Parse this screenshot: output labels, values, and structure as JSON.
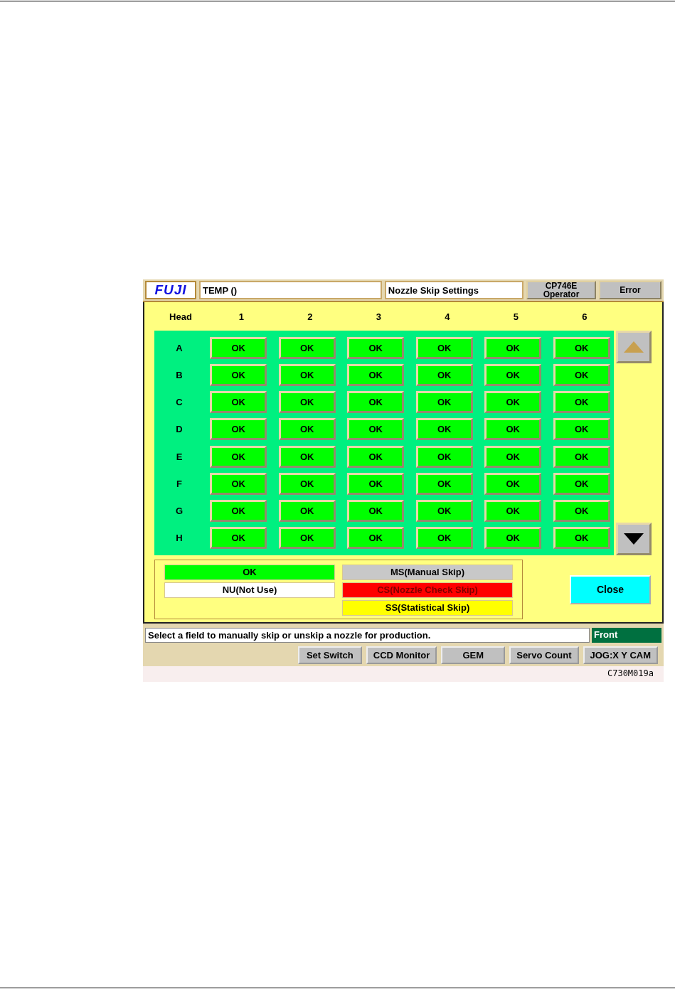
{
  "header": {
    "logo": "FUJI",
    "file": "TEMP  ()",
    "screen_title": "Nozzle Skip Settings",
    "machine": [
      "CP746E",
      "Operator"
    ],
    "error_button": "Error"
  },
  "grid": {
    "corner": "Head",
    "columns": [
      "1",
      "2",
      "3",
      "4",
      "5",
      "6"
    ],
    "rows": [
      {
        "label": "A",
        "cells": [
          {
            "color": "#00ff00",
            "text": "OK"
          },
          {
            "color": "#00ff00",
            "text": "OK"
          },
          {
            "color": "#00ff00",
            "text": "OK"
          },
          {
            "color": "#00ff00",
            "text": "OK"
          },
          {
            "color": "#00ff00",
            "text": "OK"
          },
          {
            "color": "#00ff00",
            "text": "OK"
          }
        ]
      },
      {
        "label": "B",
        "cells": [
          {
            "color": "#00ff00",
            "text": "OK"
          },
          {
            "color": "#00ff00",
            "text": "OK"
          },
          {
            "color": "#00ff00",
            "text": "OK"
          },
          {
            "color": "#00ff00",
            "text": "OK"
          },
          {
            "color": "#00ff00",
            "text": "OK"
          },
          {
            "color": "#00ff00",
            "text": "OK"
          }
        ]
      },
      {
        "label": "C",
        "cells": [
          {
            "color": "#00ff00",
            "text": "OK"
          },
          {
            "color": "#00ff00",
            "text": "OK"
          },
          {
            "color": "#00ff00",
            "text": "OK"
          },
          {
            "color": "#00ff00",
            "text": "OK"
          },
          {
            "color": "#00ff00",
            "text": "OK"
          },
          {
            "color": "#00ff00",
            "text": "OK"
          }
        ]
      },
      {
        "label": "D",
        "cells": [
          {
            "color": "#00ff00",
            "text": "OK"
          },
          {
            "color": "#00ff00",
            "text": "OK"
          },
          {
            "color": "#00ff00",
            "text": "OK"
          },
          {
            "color": "#00ff00",
            "text": "OK"
          },
          {
            "color": "#00ff00",
            "text": "OK"
          },
          {
            "color": "#00ff00",
            "text": "OK"
          }
        ]
      },
      {
        "label": "E",
        "cells": [
          {
            "color": "#00ff00",
            "text": "OK"
          },
          {
            "color": "#00ff00",
            "text": "OK"
          },
          {
            "color": "#00ff00",
            "text": "OK"
          },
          {
            "color": "#00ff00",
            "text": "OK"
          },
          {
            "color": "#00ff00",
            "text": "OK"
          },
          {
            "color": "#00ff00",
            "text": "OK"
          }
        ]
      },
      {
        "label": "F",
        "cells": [
          {
            "color": "#00ff00",
            "text": "OK"
          },
          {
            "color": "#00ff00",
            "text": "OK"
          },
          {
            "color": "#00ff00",
            "text": "OK"
          },
          {
            "color": "#00ff00",
            "text": "OK"
          },
          {
            "color": "#00ff00",
            "text": "OK"
          },
          {
            "color": "#00ff00",
            "text": "OK"
          }
        ]
      },
      {
        "label": "G",
        "cells": [
          {
            "color": "#00ff00",
            "text": "OK"
          },
          {
            "color": "#00ff00",
            "text": "OK"
          },
          {
            "color": "#00ff00",
            "text": "OK"
          },
          {
            "color": "#00ff00",
            "text": "OK"
          },
          {
            "color": "#00ff00",
            "text": "OK"
          },
          {
            "color": "#00ff00",
            "text": "OK"
          }
        ]
      },
      {
        "label": "H",
        "cells": [
          {
            "color": "#00ff00",
            "text": "OK"
          },
          {
            "color": "#00ff00",
            "text": "OK"
          },
          {
            "color": "#00ff00",
            "text": "OK"
          },
          {
            "color": "#00ff00",
            "text": "OK"
          },
          {
            "color": "#00ff00",
            "text": "OK"
          },
          {
            "color": "#00ff00",
            "text": "OK"
          }
        ]
      }
    ],
    "scroll_up": {
      "disabled": true
    },
    "scroll_down": {
      "disabled": false
    }
  },
  "legend": [
    {
      "text": "OK",
      "color": "#00ff00"
    },
    {
      "text": "MS(Manual Skip)",
      "color": "#c8c8c8"
    },
    {
      "text": "NU(Not Use)",
      "color": "#ffffff"
    },
    {
      "text": "CS(Nozzle Check Skip)",
      "color": "#ff0000"
    },
    {
      "text": "SS(Statistical Skip)",
      "color": "#ffff00"
    }
  ],
  "close_button": "Close",
  "status_bar": {
    "message": "Select a field to manually skip or unskip a nozzle for production.",
    "side": "Front"
  },
  "toolbar": [
    "Set Switch",
    "CCD Monitor",
    "GEM",
    "Servo Count",
    "JOG:X Y CAM"
  ],
  "caption": "C730M019a"
}
